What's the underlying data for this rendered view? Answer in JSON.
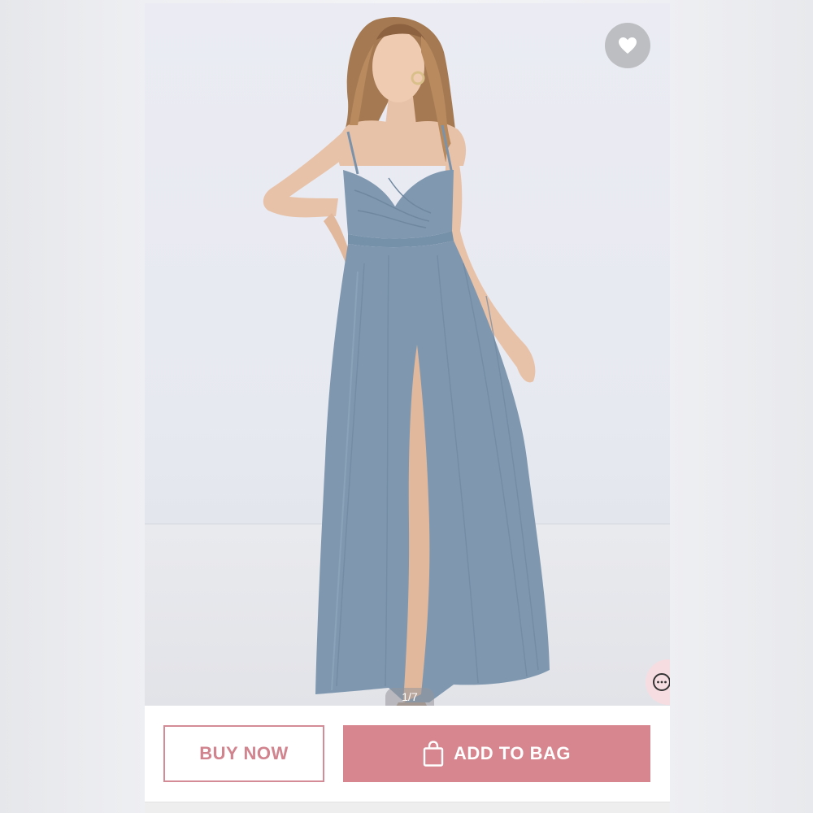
{
  "product_image": {
    "counter": "1/7",
    "dress_color": "#7f98b0",
    "background_color": "#e8eaf2"
  },
  "actions": {
    "buy_now_label": "BUY NOW",
    "add_to_bag_label": "ADD TO BAG"
  },
  "icons": {
    "favorite": "heart-icon",
    "bag": "shopping-bag-icon",
    "chat": "chat-bubble-icon"
  },
  "colors": {
    "accent": "#d7868f",
    "favorite_button": "#bdbec2",
    "chat_button": "#f6dde1"
  }
}
